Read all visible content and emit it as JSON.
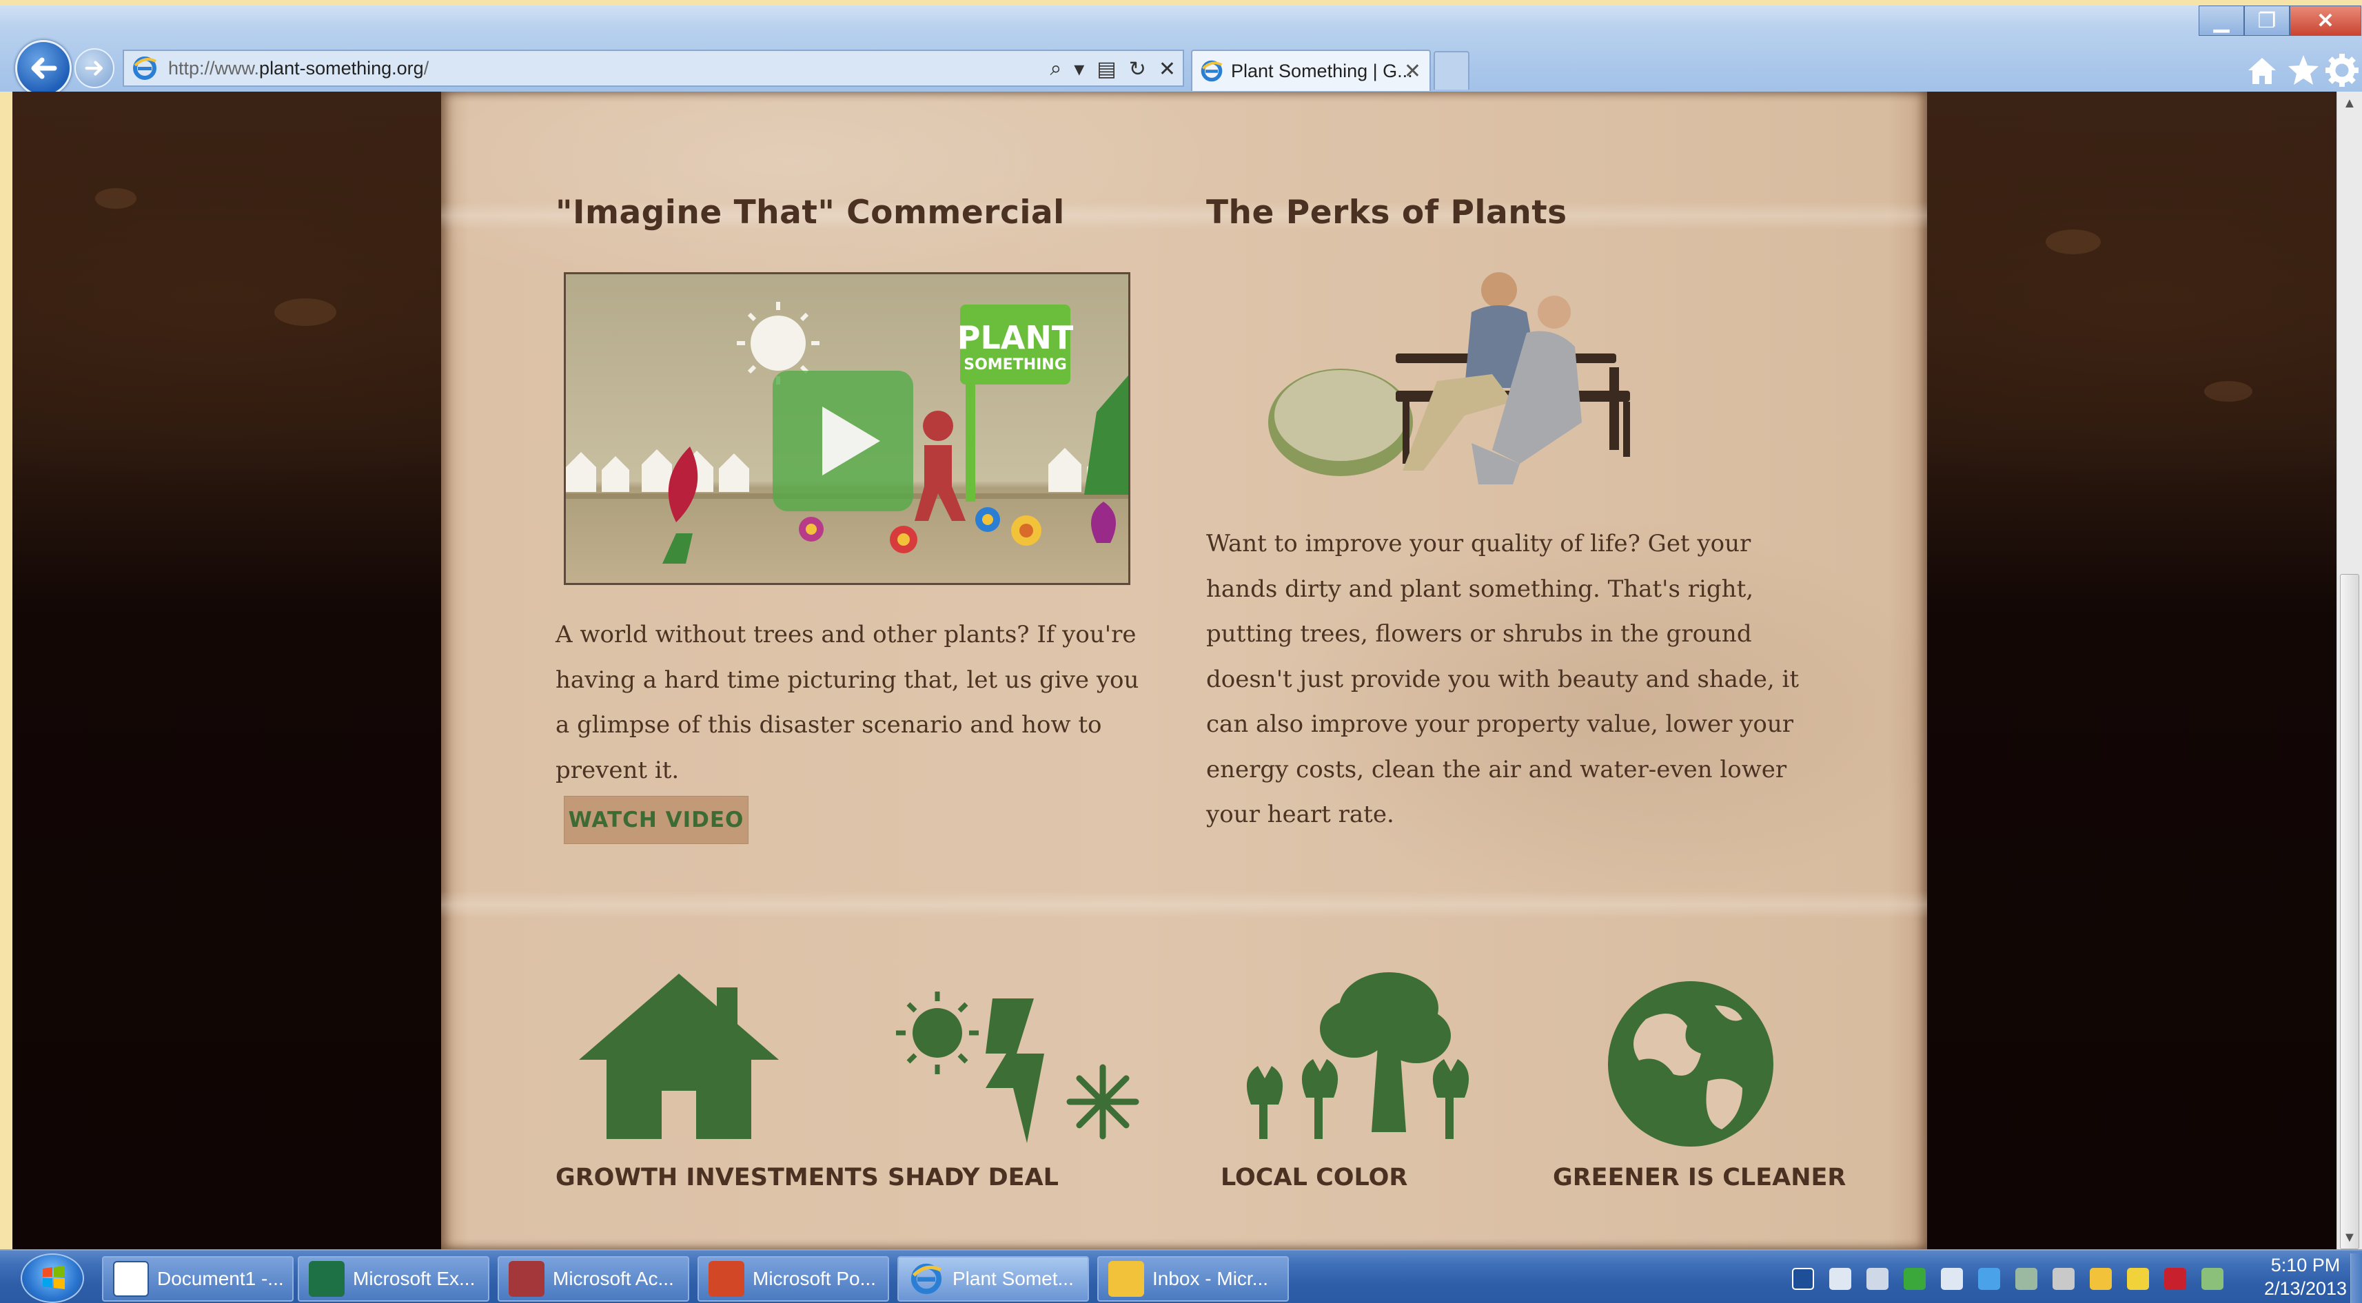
{
  "browser": {
    "url_prefix": "http://www.",
    "url_domain": "plant-something.org",
    "url_suffix": "/",
    "tab_title": "Plant Something | G...",
    "tab_close": "✕",
    "nav_back": "←",
    "nav_forward": "→",
    "window_minimize": "▁",
    "window_maximize": "❐",
    "window_close": "✕",
    "address_tools": [
      "⌕",
      "▾",
      "▤",
      "↻",
      "✕"
    ]
  },
  "page": {
    "commercial": {
      "title": "\"Imagine That\" Commercial",
      "video_sign_line1": "PLANT",
      "video_sign_line2": "SOMETHING",
      "body": "A world without trees and other plants? If you're having a hard time picturing that, let us give you a glimpse of this disaster scenario and how to prevent it.",
      "button": "WATCH VIDEO"
    },
    "perks": {
      "title": "The Perks of Plants",
      "body": "Want to improve your quality of life? Get your hands dirty and plant something. That's right, putting trees, flowers or shrubs in the ground doesn't just provide you with beauty and shade, it can also improve your property value, lower your energy costs, clean the air and water-even lower your heart rate."
    },
    "features": [
      {
        "label": "GROWTH INVESTMENTS",
        "icon": "house-icon"
      },
      {
        "label": "SHADY DEAL",
        "icon": "sun-lightning-snowflake-icon"
      },
      {
        "label": "LOCAL COLOR",
        "icon": "tree-tulips-icon"
      },
      {
        "label": "GREENER IS CLEANER",
        "icon": "globe-icon"
      }
    ],
    "colors": {
      "accent_green": "#3d6e35",
      "heading_brown": "#4a3121",
      "paper": "#dec5ab"
    }
  },
  "taskbar": {
    "items": [
      {
        "label": "Document1 -...",
        "icon": "word-icon"
      },
      {
        "label": "Microsoft Ex...",
        "icon": "excel-icon"
      },
      {
        "label": "Microsoft Ac...",
        "icon": "access-icon"
      },
      {
        "label": "Microsoft Po...",
        "icon": "powerpoint-icon"
      },
      {
        "label": "Plant Somet...",
        "icon": "ie-icon"
      },
      {
        "label": "Inbox - Micr...",
        "icon": "outlook-icon"
      }
    ],
    "clock_time": "5:10 PM",
    "clock_date": "2/13/2013"
  }
}
